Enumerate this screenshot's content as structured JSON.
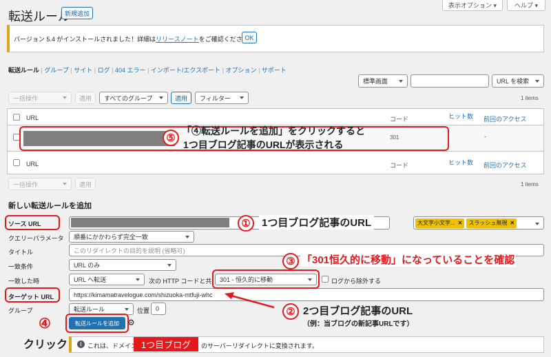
{
  "header": {
    "title": "転送ルール",
    "new_button": "新規追加",
    "screen_options": "表示オプション ▾",
    "help": "ヘルプ ▾"
  },
  "notice": {
    "text_before": "バージョン 5.4 がインストールされました！詳細は",
    "link": "リリースノート",
    "text_after": "をご確認ください。",
    "ok": "OK"
  },
  "subnav": {
    "active": "転送ルール",
    "items": [
      "グループ",
      "サイト",
      "ログ",
      "404 エラー",
      "インポート/エクスポート",
      "オプション",
      "サポート"
    ],
    "sep": "|"
  },
  "search": {
    "mode": "標準画面",
    "placeholder": "",
    "button": "URL を検索"
  },
  "top_filters": {
    "bulk": "一括操作",
    "apply": "適用",
    "group": "すべてのグループ",
    "apply2": "適用",
    "filter": "フィルター"
  },
  "count": "1 items",
  "table": {
    "col_url": "URL",
    "col_code": "コード",
    "col_hits": "ヒット数",
    "col_last": "前回のアクセス",
    "row_code": "301",
    "row_last": "-"
  },
  "bottom_filters": {
    "bulk": "一括操作",
    "apply": "適用"
  },
  "form": {
    "title": "新しい転送ルールを追加",
    "source_label": "ソース URL",
    "query_label": "クエリーパラメータ",
    "query_value": "順番にかかわらず完全一致",
    "title_label": "タイトル",
    "title_placeholder": "このリダイレクトの目的を説明 (省略可)",
    "match_label": "一致条件",
    "match_value": "URL のみ",
    "when_label": "一致した時",
    "when_value": "URL へ転送",
    "http_label": "次の HTTP コードと共に",
    "http_value": "301 - 恒久的に移動",
    "exclude_log": "ログから除外する",
    "target_label": "ターゲット URL",
    "target_value": "https://kimamatravelogue.com/shizuoka-mtfuji-whc",
    "group_label": "グループ",
    "group_value": "転送ルール",
    "position_label": "位置",
    "position_value": "0",
    "add_button": "転送ルールを追加",
    "tag1": "大文字小文字...",
    "tag2": "スラッシュ無視",
    "info_before": "これは、ドメイン",
    "info_after": "のサーバーリダイレクトに変換されます。"
  },
  "annotations": {
    "n1": "①",
    "t1": "1つ目ブログ記事のURL",
    "n2": "②",
    "t2": "2つ目ブログ記事のURL",
    "t2b": "（例：当ブログの新記事URLです）",
    "n3": "③",
    "t3": "「301恒久的に移動」になっていることを確認",
    "n4": "④",
    "t4": "クリック",
    "n5": "⑤",
    "t5a": "「④転送ルールを追加」をクリックすると",
    "t5b": "1つ目ブログ記事のURLが表示される",
    "redact": "1つ目ブログ"
  }
}
